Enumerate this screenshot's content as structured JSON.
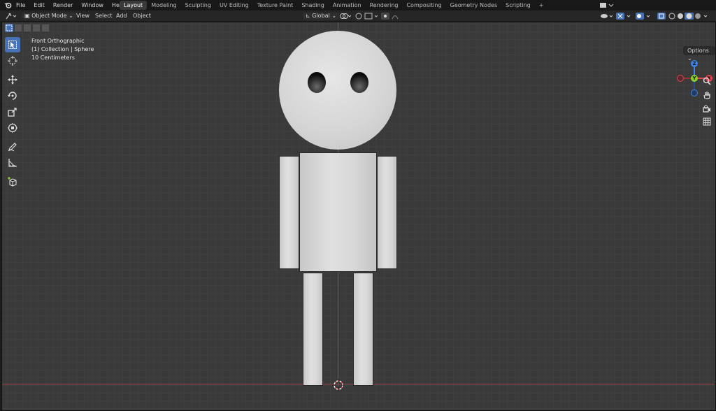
{
  "menu": {
    "items": [
      "File",
      "Edit",
      "Render",
      "Window",
      "Help"
    ]
  },
  "workspaces": {
    "tabs": [
      "Layout",
      "Modeling",
      "Sculpting",
      "UV Editing",
      "Texture Paint",
      "Shading",
      "Animation",
      "Rendering",
      "Compositing",
      "Geometry Nodes",
      "Scripting"
    ],
    "active": "Layout",
    "add": "+"
  },
  "header": {
    "mode": "Object Mode",
    "view": "View",
    "select": "Select",
    "add": "Add",
    "object": "Object",
    "orientation": "Global"
  },
  "viewport": {
    "projection": "Front Orthographic",
    "collection": "(1) Collection | Sphere",
    "scale": "10 Centimeters",
    "options": "Options"
  },
  "gizmo": {
    "z": "Z",
    "y": "Y",
    "x": "X"
  },
  "colors": {
    "accent": "#4772b3",
    "x_axis": "#e8444c",
    "y_axis": "#8bd42c",
    "z_axis": "#3f84e8"
  }
}
